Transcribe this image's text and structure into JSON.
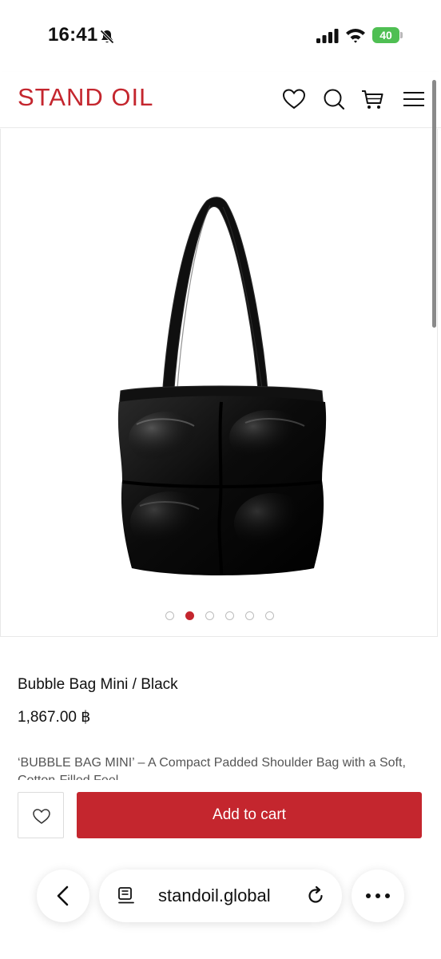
{
  "status_bar": {
    "time": "16:41",
    "battery": "40"
  },
  "header": {
    "logo": "STAND OIL",
    "icons": [
      "heart-icon",
      "search-icon",
      "cart-icon",
      "menu-icon"
    ],
    "brand_color": "#c4262e"
  },
  "gallery": {
    "image_count": 6,
    "active_index": 1
  },
  "product": {
    "title": "Bubble Bag Mini / Black",
    "price": "1,867.00 ฿",
    "description": "‘BUBBLE BAG MINI’ – A Compact Padded Shoulder Bag with a Soft, Cotton-Filled Feel"
  },
  "actions": {
    "add_to_cart": "Add to cart"
  },
  "browser": {
    "url": "standoil.global"
  }
}
